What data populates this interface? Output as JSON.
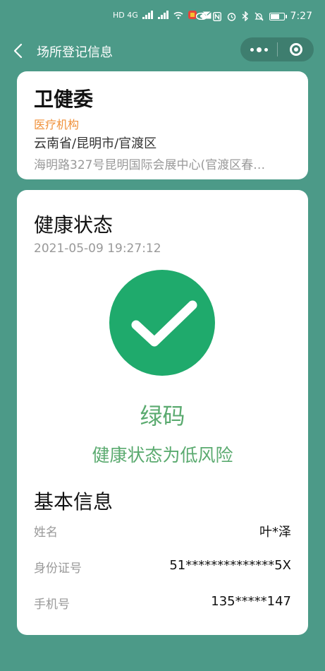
{
  "status_bar": {
    "network_left": "HD 4G",
    "time": "7:27"
  },
  "navbar": {
    "title": "场所登记信息"
  },
  "place": {
    "name": "卫健委",
    "type": "医疗机构",
    "region": "云南省/昆明市/官渡区",
    "address": "海明路327号昆明国际会展中心(官渡区春…"
  },
  "health": {
    "title": "健康状态",
    "timestamp": "2021-05-09 19:27:12",
    "code_label": "绿码",
    "risk_label": "健康状态为低风险"
  },
  "basic_info": {
    "title": "基本信息",
    "rows": [
      {
        "label": "姓名",
        "value": "叶*泽"
      },
      {
        "label": "身份证号",
        "value": "51**************5X"
      },
      {
        "label": "手机号",
        "value": "135*****147"
      }
    ]
  },
  "colors": {
    "background": "#4c9a88",
    "green_code": "#1faa6c",
    "green_text": "#5aaa6f",
    "orange_tag": "#f0913a"
  }
}
